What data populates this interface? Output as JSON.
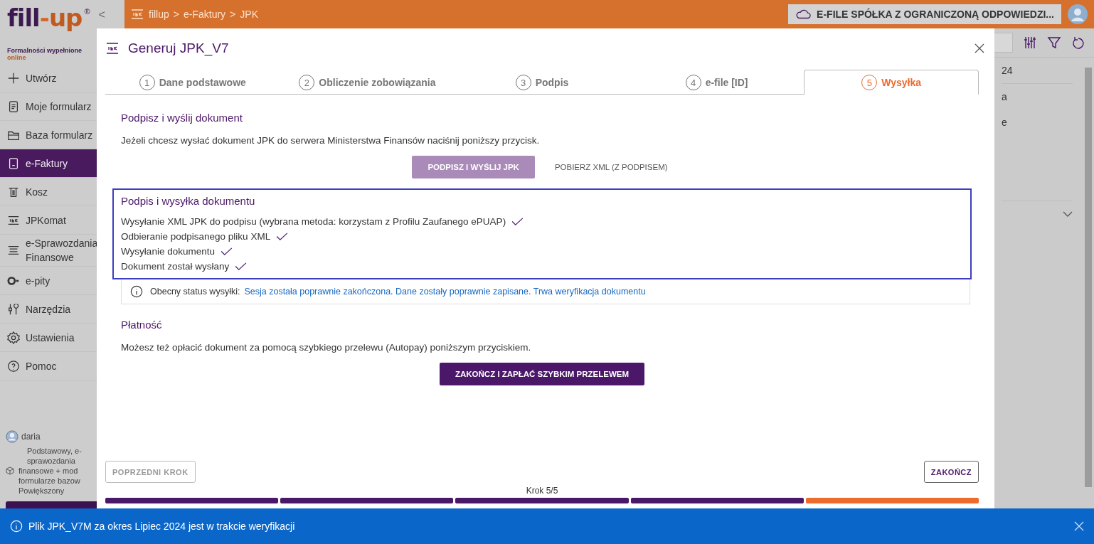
{
  "sidebar": {
    "logo": {
      "brand_left": "fill",
      "brand_dash": "-",
      "brand_right": "up",
      "registered": "®",
      "tagline": "Formalności wypełnione",
      "tagline_accent": "online"
    },
    "collapse": "<",
    "items": [
      {
        "label": "Utwórz",
        "selected": false
      },
      {
        "label": "Moje formularz",
        "selected": false
      },
      {
        "label": "Baza formularz",
        "selected": false
      },
      {
        "label": "e-Faktury",
        "selected": true
      },
      {
        "label": "Kosz",
        "selected": false
      },
      {
        "label": "JPKomat",
        "selected": false
      },
      {
        "label": "e-Sprawozdania",
        "label_2": "Finansowe",
        "selected": false
      },
      {
        "label": "e-pity",
        "selected": false
      },
      {
        "label": "Narzędzia",
        "selected": false
      },
      {
        "label": "Ustawienia",
        "selected": false
      },
      {
        "label": "Pomoc",
        "selected": false
      }
    ],
    "user": {
      "name": "daria",
      "plan_lines": [
        "Podstawowy, e-",
        "sprawozdania",
        "finansowe + mod",
        "formularze bazow",
        "Powiększony"
      ]
    }
  },
  "top_bar": {
    "breadcrumb": [
      "fillup",
      "e-Faktury",
      "JPK"
    ],
    "separator": ">",
    "company": "E-FILE SPÓŁKA Z OGRANICZONĄ ODPOWIEDZI..."
  },
  "background": {
    "column_fragments": [
      "24",
      "a",
      "e"
    ]
  },
  "dialog": {
    "title": "Generuj JPK_V7",
    "tabs": [
      {
        "number": "1",
        "label": "Dane podstawowe",
        "selected": false
      },
      {
        "number": "2",
        "label": "Obliczenie zobowiązania",
        "selected": false
      },
      {
        "number": "3",
        "label": "Podpis",
        "selected": false
      },
      {
        "number": "4",
        "label": "e-file [ID]",
        "selected": false
      },
      {
        "number": "5",
        "label": "Wysyłka",
        "selected": true
      }
    ],
    "sign_section": {
      "heading": "Podpisz i wyślij dokument",
      "text": "Jeżeli chcesz wysłać dokument JPK do serwera Ministerstwa Finansów naciśnij poniższy przycisk.",
      "primary_button": {
        "label": "PODPISZ I WYŚLIJ JPK",
        "disabled": true
      },
      "secondary_button": "POBIERZ XML (Z PODPISEM)"
    },
    "progress_box": {
      "heading": "Podpis i wysyłka dokumentu",
      "steps": [
        {
          "label": "Wysyłanie XML JPK do podpisu (wybrana metoda: korzystam z Profilu Zaufanego ePUAP)",
          "done": true
        },
        {
          "label": "Odbieranie podpisanego pliku XML",
          "done": true
        },
        {
          "label": "Wysyłanie dokumentu",
          "done": true
        },
        {
          "label": "Dokument został wysłany",
          "done": true
        }
      ]
    },
    "status": {
      "label": "Obecny status wysyłki:",
      "value": "Sesja została poprawnie zakończona. Dane zostały poprawnie zapisane. Trwa weryfikacja dokumentu"
    },
    "payment": {
      "heading": "Płatność",
      "text": "Możesz też opłacić dokument za pomocą szybkiego przelewu (Autopay) poniższym przyciskiem.",
      "button": "ZAKOŃCZ I ZAPŁAĆ SZYBKIM PRZELEWEM"
    },
    "footer": {
      "back_button": "POPRZEDNI KROK",
      "finish_button": "ZAKOŃCZ",
      "step_label": "Krok 5/5",
      "segments": [
        {
          "done": true
        },
        {
          "done": true
        },
        {
          "done": true
        },
        {
          "done": true
        },
        {
          "done": false
        }
      ]
    }
  },
  "notification": {
    "text": "Plik JPK_V7M za okres Lipiec 2024 jest w trakcie weryfikacji"
  }
}
